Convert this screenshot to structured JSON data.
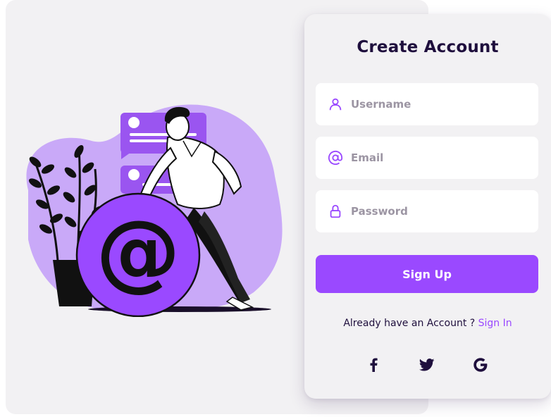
{
  "signup_form": {
    "title": "Create Account",
    "fields": [
      {
        "name": "username",
        "placeholder": "Username",
        "value": "",
        "icon": "user-icon"
      },
      {
        "name": "email",
        "placeholder": "Email",
        "value": "",
        "icon": "at-sign-icon"
      },
      {
        "name": "password",
        "placeholder": "Password",
        "value": "",
        "icon": "lock-icon"
      }
    ],
    "submit_label": "Sign Up",
    "signin_prompt": "Already have an Account ?",
    "signin_link": "Sign In",
    "social_icons": [
      "facebook-icon",
      "twitter-icon",
      "google-icon"
    ]
  },
  "illustration": {
    "icon": "email-at-sign-illustration"
  },
  "colors": {
    "accent": "#9a49ff",
    "title": "#1f0f3d",
    "panel_bg": "#f2f1f3",
    "blob": "#c9a9f8",
    "chat_bubble": "#9a55f0",
    "field_bg": "#ffffff"
  }
}
